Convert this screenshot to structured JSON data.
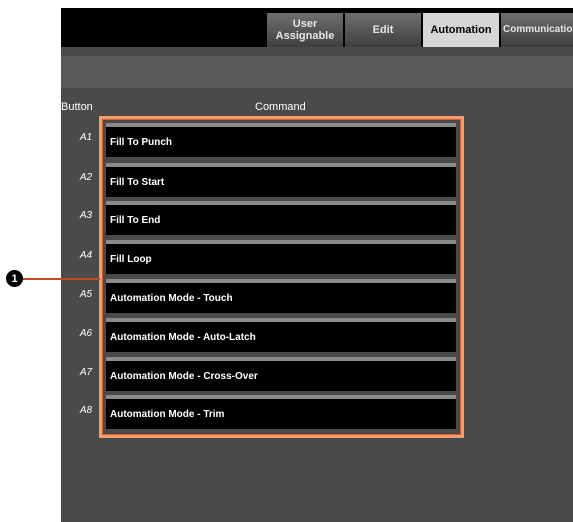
{
  "tabs": [
    {
      "label": "User\nAssignable"
    },
    {
      "label": "Edit"
    },
    {
      "label": "Automation"
    },
    {
      "label": "Communication"
    }
  ],
  "table": {
    "col_button": "Button",
    "col_command": "Command",
    "rows": [
      {
        "button": "A1",
        "command": "Fill To Punch"
      },
      {
        "button": "A2",
        "command": "Fill To Start"
      },
      {
        "button": "A3",
        "command": "Fill To End"
      },
      {
        "button": "A4",
        "command": "Fill Loop"
      },
      {
        "button": "A5",
        "command": "Automation Mode - Touch"
      },
      {
        "button": "A6",
        "command": "Automation Mode - Auto-Latch"
      },
      {
        "button": "A7",
        "command": "Automation Mode - Cross-Over"
      },
      {
        "button": "A8",
        "command": "Automation Mode - Trim"
      }
    ]
  },
  "callout": {
    "number": "1"
  },
  "colors": {
    "highlight": "#e05a2a",
    "active_tab": "#d6d6d6",
    "panel": "#4a4a4a"
  }
}
